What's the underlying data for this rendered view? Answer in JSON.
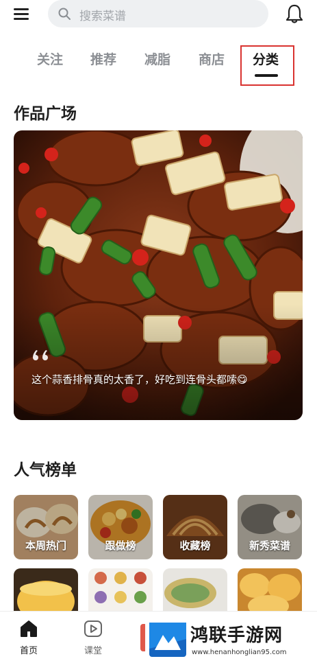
{
  "search": {
    "placeholder": "搜索菜谱"
  },
  "tabs": [
    {
      "label": "关注"
    },
    {
      "label": "推荐"
    },
    {
      "label": "减脂"
    },
    {
      "label": "商店"
    },
    {
      "label": "分类"
    }
  ],
  "active_tab": "分类",
  "sections": {
    "works": "作品广场",
    "ranking": "人气榜单"
  },
  "feature": {
    "caption": "这个蒜香排骨真的太香了，好吃到连骨头都嗦😋"
  },
  "rankings": [
    {
      "label": "本周热门"
    },
    {
      "label": "跟做榜"
    },
    {
      "label": "收藏榜"
    },
    {
      "label": "新秀菜谱"
    }
  ],
  "bottom_nav": [
    {
      "label": "首页"
    },
    {
      "label": "课堂"
    }
  ],
  "watermark": {
    "title": "鸿联手游网",
    "url": "www.henanhonglian95.com"
  },
  "colors": {
    "highlight_box": "#d9322f",
    "search_bg": "#eef0f2"
  },
  "icons": [
    "menu-icon",
    "search-icon",
    "bell-icon",
    "quote-icon",
    "home-icon",
    "play-icon"
  ]
}
